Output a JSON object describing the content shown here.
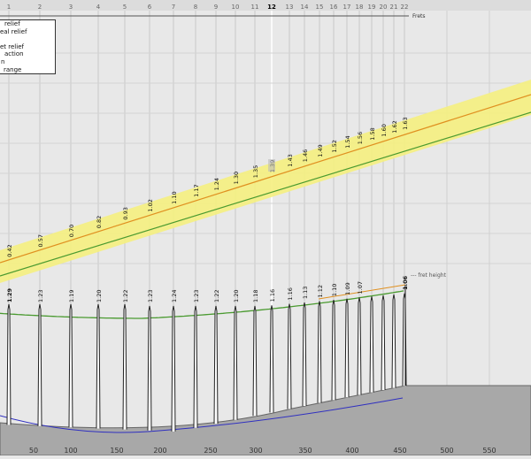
{
  "header": {
    "frets_label": "Frets",
    "fret_numbers": [
      "1",
      "2",
      "3",
      "4",
      "5",
      "6",
      "7",
      "8",
      "9",
      "10",
      "11",
      "12",
      "13",
      "14",
      "15",
      "16",
      "17",
      "18",
      "19",
      "20",
      "21",
      "22"
    ],
    "highlight_fret": "12"
  },
  "legend": {
    "items": [
      "relief",
      "eal relief",
      "",
      "et relief",
      "action",
      "n",
      "range"
    ]
  },
  "relief_values": [
    "0.42",
    "0.57",
    "0.70",
    "0.82",
    "0.93",
    "1.02",
    "1.10",
    "1.17",
    "1.24",
    "1.30",
    "1.35",
    "1.39",
    "1.43",
    "1.46",
    "1.49",
    "1.52",
    "1.54",
    "1.56",
    "1.58",
    "1.60",
    "1.62",
    "1.63"
  ],
  "fret_height_values": [
    "1.29",
    "1.23",
    "1.19",
    "1.20",
    "1.22",
    "1.23",
    "1.24",
    "1.23",
    "1.22",
    "1.20",
    "1.18",
    "1.16",
    "1.16",
    "1.13",
    "1.12",
    "1.10",
    "1.09",
    "1.07",
    "1.06"
  ],
  "fret_height_label": "--- fret height",
  "x_axis_labels": [
    "50",
    "100",
    "150",
    "200",
    "250",
    "300",
    "350",
    "400",
    "450",
    "500",
    "550"
  ],
  "colors": {
    "background": "#e8e8e8",
    "gridline": "#c8c8c8",
    "band": "#f5f080",
    "red_line": "#e09020",
    "green_line": "#4a9a30",
    "blue_line": "#3030c0",
    "body_fill": "#a8a8a8"
  }
}
